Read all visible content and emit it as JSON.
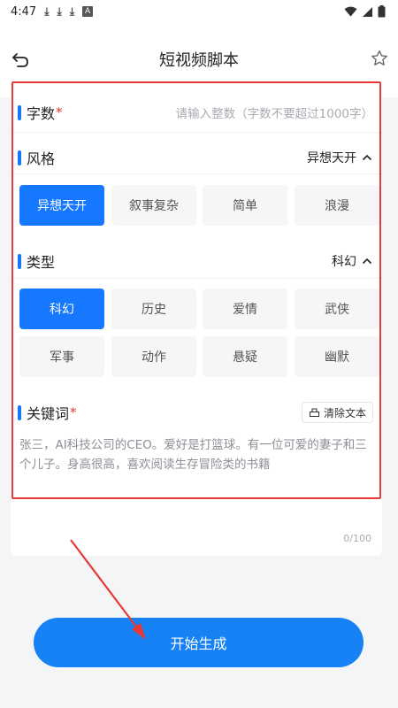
{
  "status_bar": {
    "time": "4:47",
    "notification_icons": [
      "download-icon",
      "download-icon",
      "download-icon",
      "text-app-icon"
    ],
    "right_icons": [
      "wifi-icon",
      "signal-icon",
      "battery-icon"
    ]
  },
  "header": {
    "title": "短视频脚本",
    "back_icon": "back-arrow-icon",
    "favorite_icon": "star-icon"
  },
  "form": {
    "word_count": {
      "label": "字数",
      "required_mark": "*",
      "placeholder": "请输入整数（字数不要超过1000字）"
    },
    "style": {
      "label": "风格",
      "selected": "异想天开",
      "options": [
        "异想天开",
        "叙事复杂",
        "简单",
        "浪漫"
      ]
    },
    "type": {
      "label": "类型",
      "selected": "科幻",
      "options": [
        "科幻",
        "历史",
        "爱情",
        "武侠",
        "军事",
        "动作",
        "悬疑",
        "幽默"
      ]
    },
    "keywords": {
      "label": "关键词",
      "required_mark": "*",
      "clear_label": "清除文本",
      "text": "张三，AI科技公司的CEO。爱好是打篮球。有一位可爱的妻子和三个儿子。身高很高，喜欢阅读生存冒险类的书籍",
      "counter": "0/100"
    }
  },
  "submit": {
    "label": "开始生成"
  },
  "colors": {
    "accent": "#1677ff",
    "button": "#1682f5",
    "required": "#e53935",
    "annotation": "#e53935"
  }
}
